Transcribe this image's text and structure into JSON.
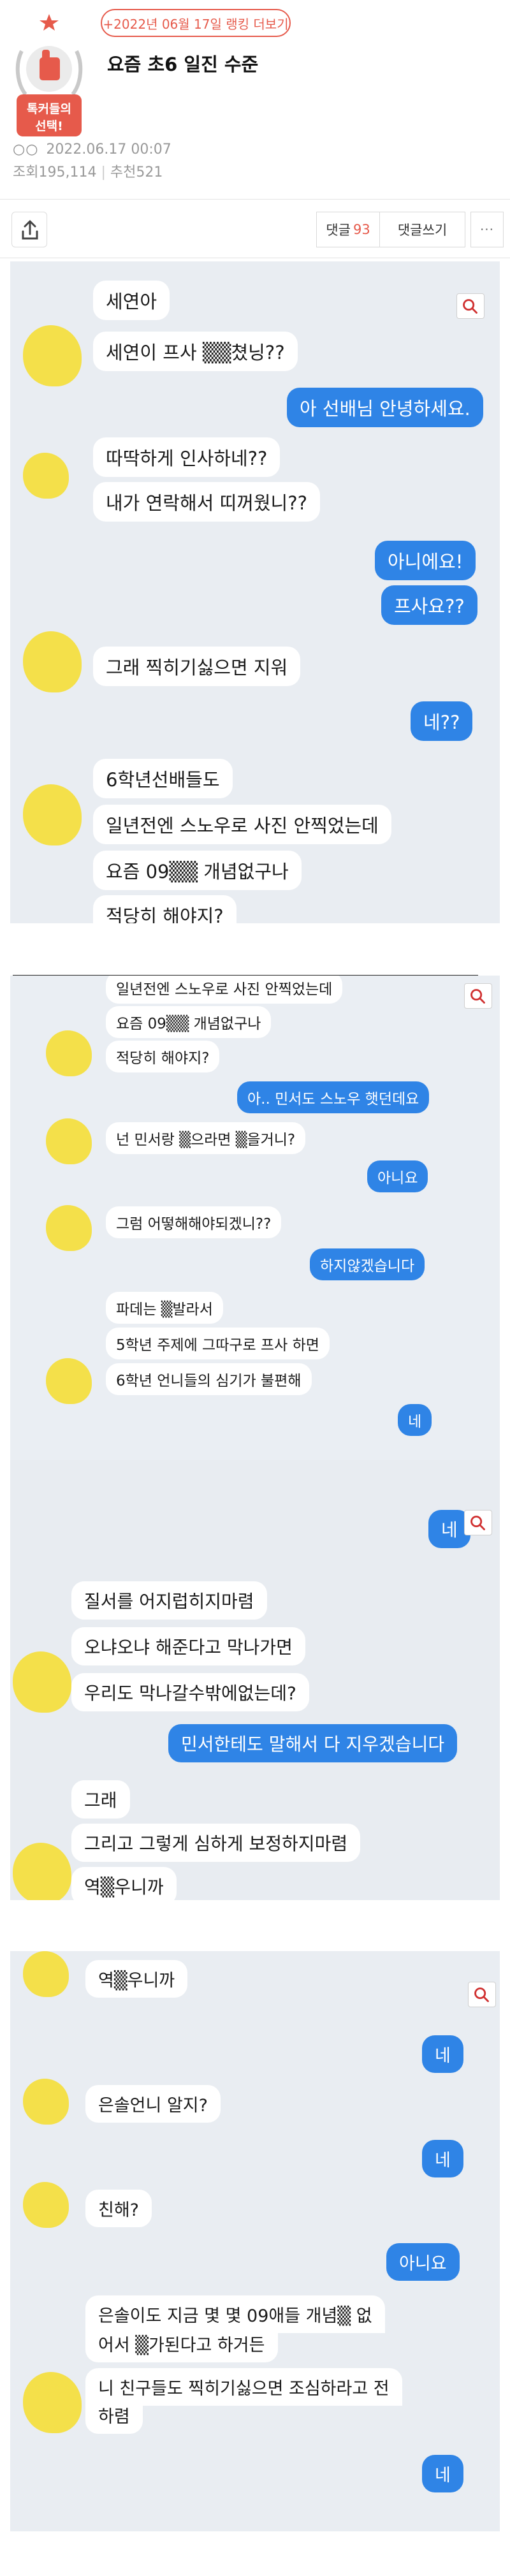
{
  "header": {
    "rank_link": "+2022년 06월 17일 랭킹 더보기",
    "badge_label": "톡커들의 선택!",
    "title": "요즘 초6 일진 수준",
    "author_dots": "○○",
    "date": "2022.06.17 00:07",
    "views_label": "조회",
    "views": "195,114",
    "recommend_label": "추천",
    "recommend": "521",
    "comments_label": "댓글",
    "comments_count": "93",
    "write_comment": "댓글쓰기",
    "more": "···",
    "colors": {
      "accent": "#e65a4b"
    }
  },
  "chat1": [
    "세연아",
    "세연이 프사 ▒▒쳤닝??",
    "아 선배님 안녕하세요.",
    "따딱하게 인사하네??",
    "내가 연락해서 띠꺼웠니??",
    "아니에요!",
    "프사요??",
    "그래 찍히기싫으면 지워",
    "네??",
    "6학년선배들도",
    "일년전엔 스노우로 사진 안찍었는데",
    "요즘 09▒▒ 개념없구나",
    "적당히 해야지?"
  ],
  "chat2": [
    "일년전엔 스노우로 사진 안찍었는데",
    "요즘 09▒▒ 개념없구나",
    "적당히 해야지?",
    "아.. 민서도 스노우 햇던데요",
    "넌 민서랑 ▒으라면 ▒을거니?",
    "아니요",
    "그럼 어떻해해야되겠니??",
    "하지않겠습니다",
    "파데는 ▒발라서",
    "5학년 주제에 그따구로 프사 하면",
    "6학년 언니들의 심기가 불편해",
    "네"
  ],
  "chat3": [
    "네",
    "질서를 어지럽히지마렴",
    "오냐오냐 해준다고 막나가면",
    "우리도 막나갈수밖에없는데?",
    "민서한테도 말해서 다 지우겠습니다",
    "그래",
    "그리고 그렇게 심하게 보정하지마렴",
    "역▒우니까"
  ],
  "chat4": [
    "역▒우니까",
    "네",
    "은솔언니 알지?",
    "네",
    "친해?",
    "아니요",
    "은솔이도 지금 몇 몇 09애들 개념▒ 없",
    "어서 ▒가된다고 하거든",
    "니 친구들도 찍히기싫으면 조심하라고 전",
    "하렴",
    "네"
  ]
}
